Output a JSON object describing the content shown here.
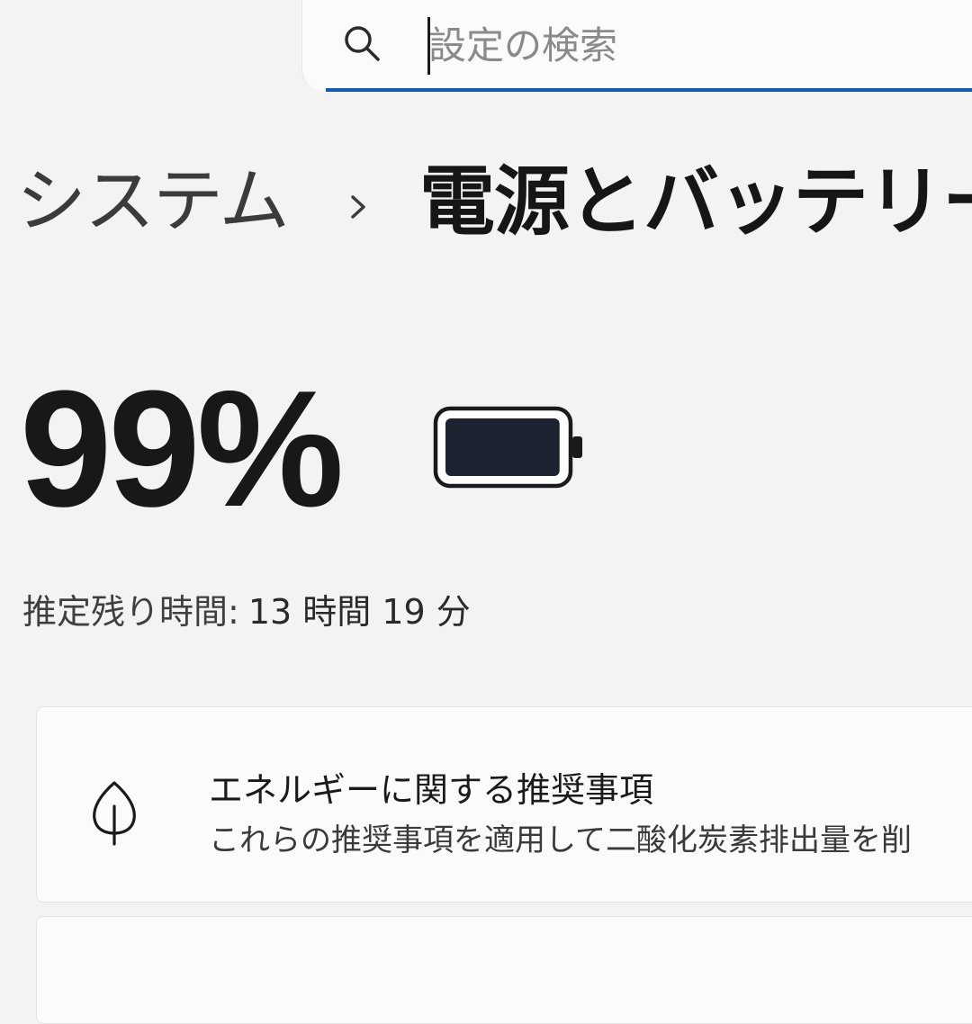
{
  "search": {
    "placeholder": "設定の検索",
    "icon": "search-icon"
  },
  "breadcrumb": {
    "parent": "システム",
    "separator_icon": "chevron-right-icon",
    "current": "電源とバッテリー"
  },
  "battery": {
    "percent_text": "99%",
    "level": 0.99,
    "icon": "battery-icon",
    "remaining_label": "推定残り時間:",
    "remaining_value": "13 時間 19 分"
  },
  "energy_card": {
    "icon": "leaf-icon",
    "title": "エネルギーに関する推奨事項",
    "description": "これらの推奨事項を適用して二酸化炭素排出量を削"
  },
  "colors": {
    "background": "#f3f3f3",
    "card": "#fbfbfb",
    "accent": "#0f5bb5",
    "text": "#1a1a1a"
  }
}
